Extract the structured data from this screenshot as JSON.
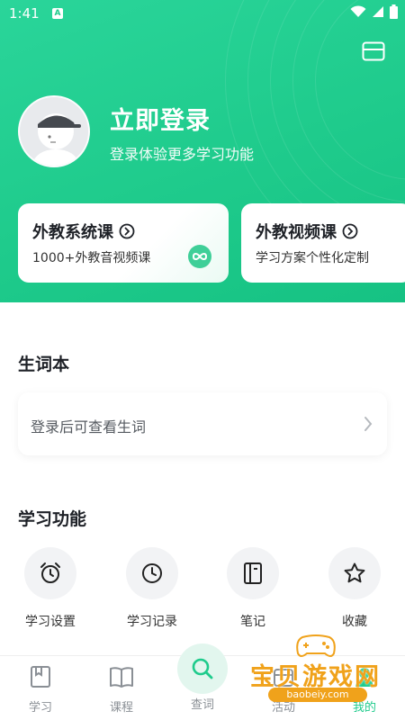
{
  "status_bar": {
    "time": "1:41",
    "app_badge": "A"
  },
  "header": {
    "login_title": "立即登录",
    "login_subtitle": "登录体验更多学习功能"
  },
  "promo_cards": [
    {
      "title": "外教系统课",
      "subtitle": "1000+外教音视频课"
    },
    {
      "title": "外教视频课",
      "subtitle": "学习方案个性化定制"
    }
  ],
  "vocab": {
    "section_title": "生词本",
    "placeholder": "登录后可查看生词"
  },
  "features": {
    "section_title": "学习功能",
    "items": [
      {
        "label": "学习设置",
        "icon": "alarm-clock-icon"
      },
      {
        "label": "学习记录",
        "icon": "clock-icon"
      },
      {
        "label": "笔记",
        "icon": "notebook-icon"
      },
      {
        "label": "收藏",
        "icon": "star-icon"
      }
    ]
  },
  "tabbar": {
    "tabs": [
      {
        "label": "学习",
        "icon": "bookmark-icon"
      },
      {
        "label": "课程",
        "icon": "book-icon"
      },
      {
        "label": "查词",
        "icon": "search-icon"
      },
      {
        "label": "活动",
        "icon": "activity-icon"
      },
      {
        "label": "我的",
        "icon": "profile-icon"
      }
    ],
    "active_color": "#1fcb8c"
  },
  "watermark": {
    "text": "宝贝游戏网",
    "url": "baobeiy.com"
  },
  "colors": {
    "brand": "#1fcb8c",
    "text_dark": "#1e2127"
  }
}
